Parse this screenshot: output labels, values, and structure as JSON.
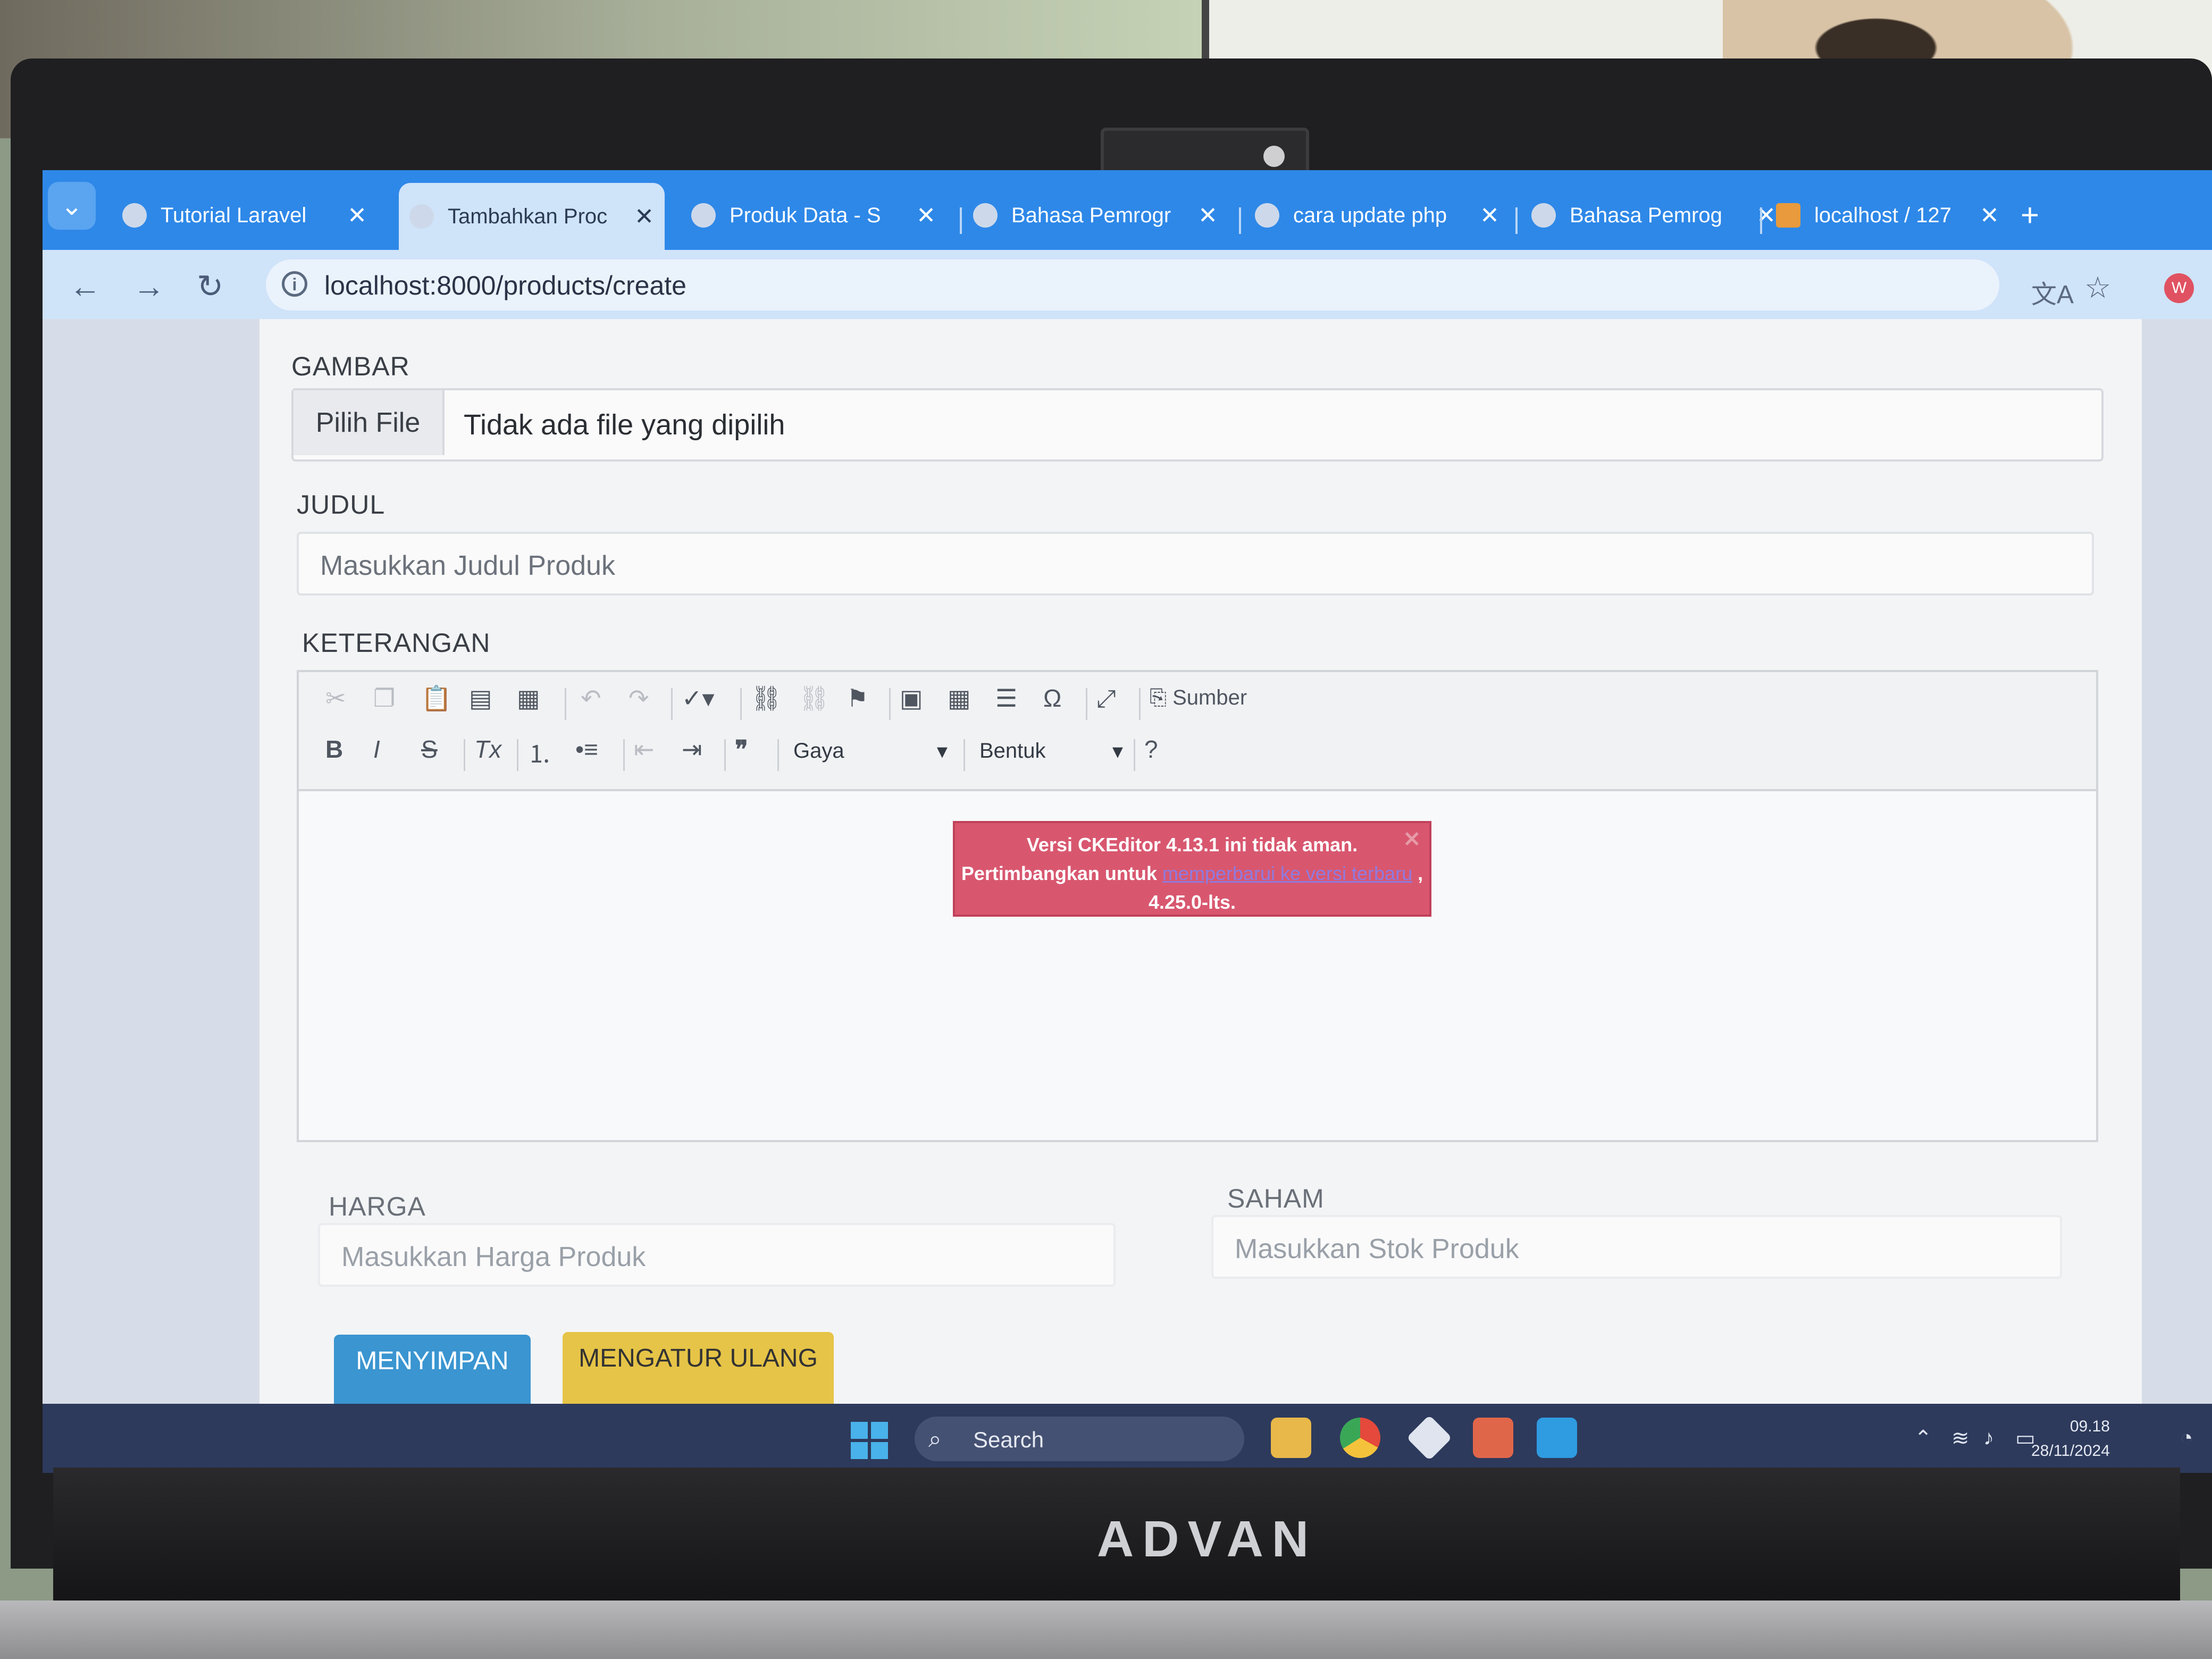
{
  "browser": {
    "tabs": [
      {
        "title": "Tutorial Laravel",
        "active": false
      },
      {
        "title": "Tambahkan Proc",
        "active": true
      },
      {
        "title": "Produk Data - S",
        "active": false
      },
      {
        "title": "Bahasa Pemrogr",
        "active": false
      },
      {
        "title": "cara update php",
        "active": false
      },
      {
        "title": "Bahasa Pemrog",
        "active": false
      },
      {
        "title": "localhost / 127",
        "active": false
      }
    ],
    "tab_close_glyph": "✕",
    "new_tab_glyph": "+",
    "url": "localhost:8000/products/create"
  },
  "form": {
    "image_label": "GAMBAR",
    "file_button": "Pilih File",
    "file_status": "Tidak ada file yang dipilih",
    "title_label": "JUDUL",
    "title_placeholder": "Masukkan Judul Produk",
    "description_label": "KETERANGAN",
    "price_label": "HARGA",
    "price_placeholder": "Masukkan Harga Produk",
    "stock_label": "SAHAM",
    "stock_placeholder": "Masukkan Stok Produk",
    "save_button": "MENYIMPAN",
    "reset_button": "MENGATUR ULANG"
  },
  "editor": {
    "source_button": "Sumber",
    "style_combo": "Gaya",
    "format_combo": "Bentuk",
    "help": "?",
    "notice_line1": "Versi CKEditor 4.13.1 ini tidak aman.",
    "notice_line2_prefix": "Pertimbangkan untuk",
    "notice_link": "memperbarui ke versi terbaru",
    "notice_suffix": ", 4.25.0-lts."
  },
  "taskbar": {
    "search_placeholder": "Search",
    "time": "09.18",
    "date": "28/11/2024"
  },
  "device": {
    "brand": "ADVAN"
  },
  "colors": {
    "browser_blue": "#2e88e8",
    "save_button": "#3a95d0",
    "reset_button": "#e6c447",
    "notice_bg": "#d8576f"
  }
}
